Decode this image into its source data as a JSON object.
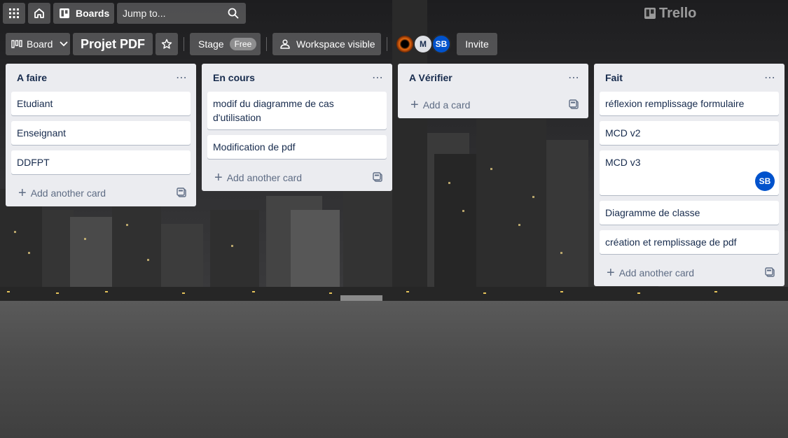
{
  "topbar": {
    "apps_icon": "grid-icon",
    "home_icon": "home-icon",
    "boards_label": "Boards",
    "search_placeholder": "Jump to...",
    "brand": "Trello"
  },
  "board_header": {
    "view_label": "Board",
    "title": "Projet PDF",
    "stage_label": "Stage",
    "stage_badge": "Free",
    "visibility_label": "Workspace visible",
    "members": [
      {
        "initials": "",
        "kind": "photo"
      },
      {
        "initials": "M",
        "color": "#dfe1e6"
      },
      {
        "initials": "SB",
        "color": "#0052cc"
      }
    ],
    "invite_label": "Invite"
  },
  "lists": [
    {
      "title": "A faire",
      "cards": [
        {
          "text": "Etudiant"
        },
        {
          "text": "Enseignant"
        },
        {
          "text": "DDFPT"
        }
      ],
      "add_label": "Add another card"
    },
    {
      "title": "En cours",
      "cards": [
        {
          "text": "modif du diagramme de cas d'utilisation"
        },
        {
          "text": "Modification de pdf"
        }
      ],
      "add_label": "Add another card"
    },
    {
      "title": "A Vérifier",
      "cards": [],
      "add_label": "Add a card"
    },
    {
      "title": "Fait",
      "cards": [
        {
          "text": "réflexion remplissage formulaire"
        },
        {
          "text": "MCD v2"
        },
        {
          "text": "MCD v3",
          "member": "SB"
        },
        {
          "text": "Diagramme de classe"
        },
        {
          "text": "création et remplissage de pdf"
        }
      ],
      "add_label": "Add another card"
    }
  ],
  "colors": {
    "list_bg": "#ebecf0",
    "card_bg": "#ffffff",
    "member_blue": "#0052cc"
  }
}
